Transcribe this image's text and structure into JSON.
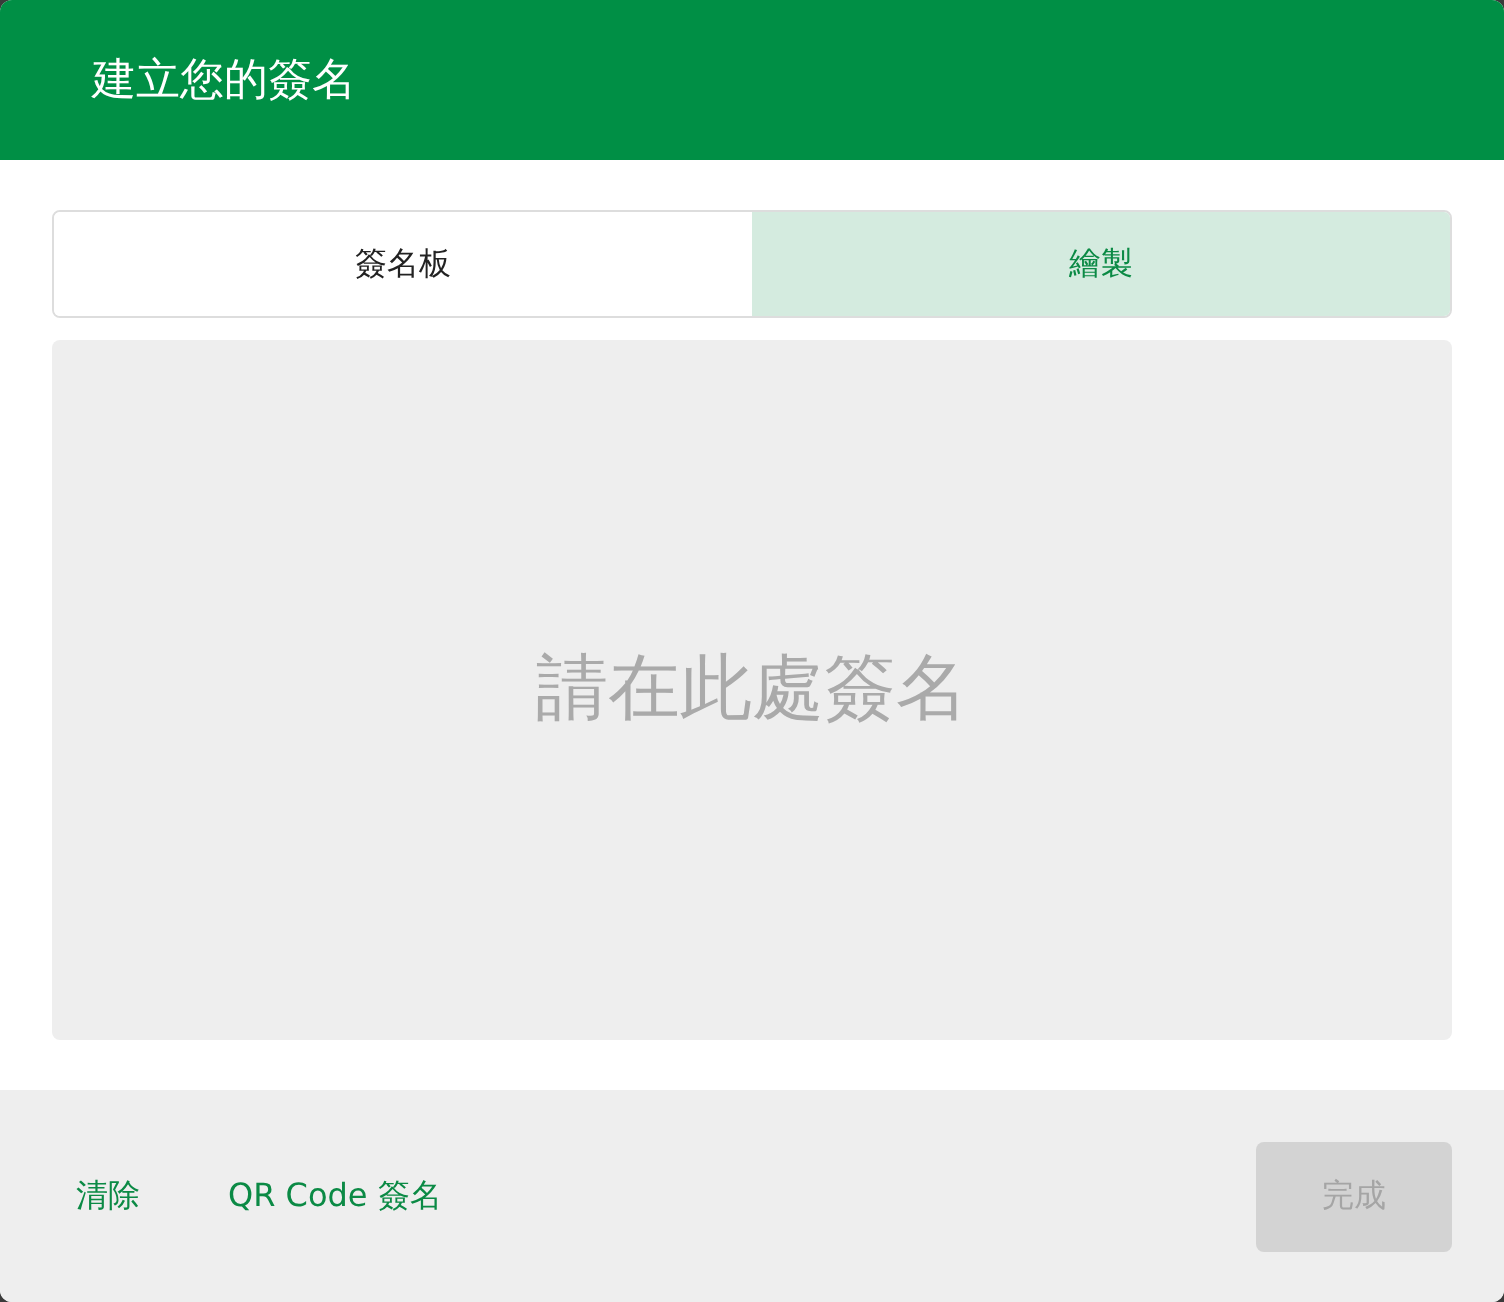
{
  "dialog": {
    "title": "建立您的簽名"
  },
  "tabs": [
    {
      "label": "簽名板",
      "selected": false
    },
    {
      "label": "繪製",
      "selected": true
    }
  ],
  "signature_pad": {
    "placeholder": "請在此處簽名"
  },
  "footer": {
    "links": [
      "清除",
      "QR Code 簽名"
    ],
    "done_button": {
      "label": "完成",
      "disabled": true
    }
  }
}
